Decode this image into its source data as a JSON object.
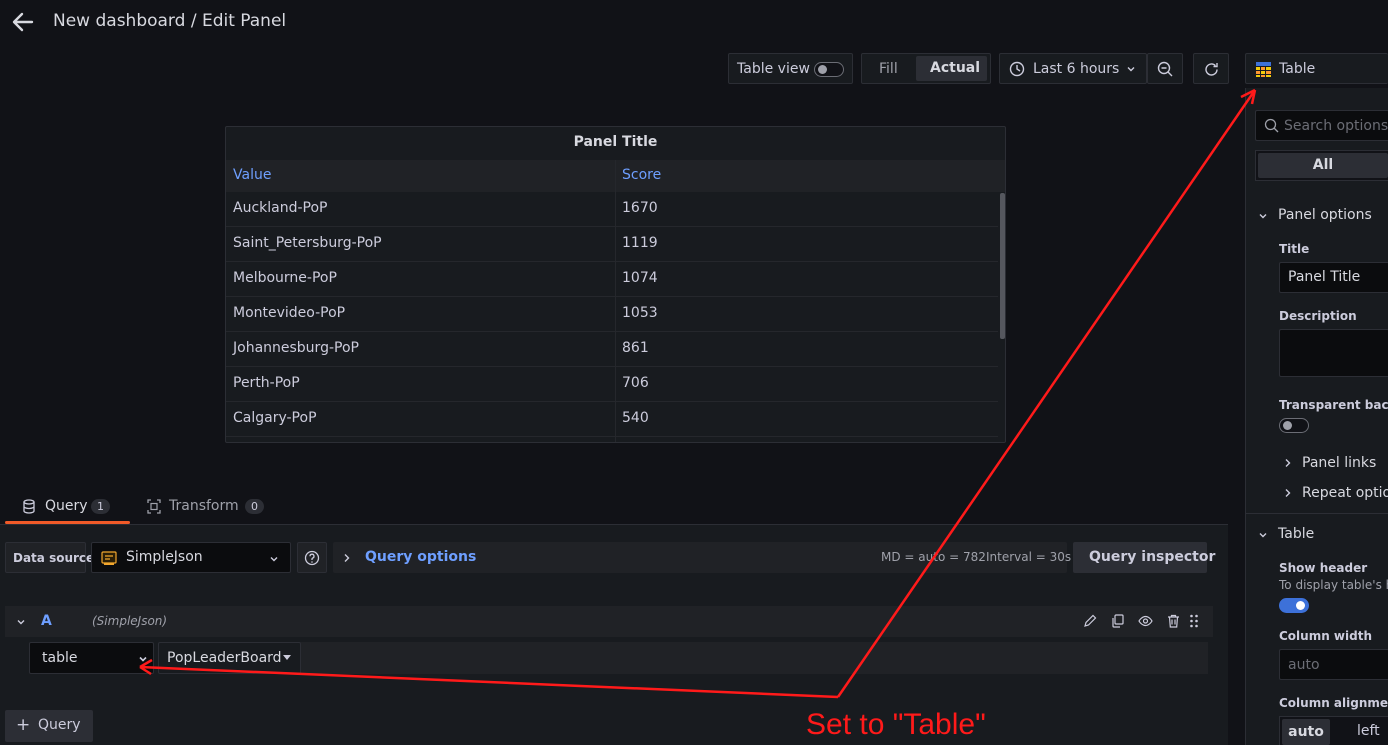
{
  "header": {
    "title": "New dashboard / Edit Panel"
  },
  "toolbar": {
    "table_view_label": "Table view",
    "fill_label": "Fill",
    "actual_label": "Actual",
    "time_range": "Last 6 hours"
  },
  "viz_picker": {
    "label": "Table"
  },
  "panel": {
    "title": "Panel Title",
    "columns": [
      "Value",
      "Score"
    ],
    "rows": [
      {
        "value": "Auckland-PoP",
        "score": "1670"
      },
      {
        "value": "Saint_Petersburg-PoP",
        "score": "1119"
      },
      {
        "value": "Melbourne-PoP",
        "score": "1074"
      },
      {
        "value": "Montevideo-PoP",
        "score": "1053"
      },
      {
        "value": "Johannesburg-PoP",
        "score": "861"
      },
      {
        "value": "Perth-PoP",
        "score": "706"
      },
      {
        "value": "Calgary-PoP",
        "score": "540"
      }
    ]
  },
  "query_tabs": {
    "query_label": "Query",
    "query_count": "1",
    "transform_label": "Transform",
    "transform_count": "0"
  },
  "query_bar": {
    "data_source_label": "Data source",
    "data_source_value": "SimpleJson",
    "query_options_label": "Query options",
    "md_text": "MD = auto = 782",
    "interval_text": "Interval = 30s",
    "inspector_label": "Query inspector"
  },
  "query_row": {
    "ref_id": "A",
    "datasource_hint": "(SimpleJson)",
    "format_value": "table",
    "target_value": "PopLeaderBoard"
  },
  "add_query_label": "Query",
  "options": {
    "search_placeholder": "Search options",
    "all_label": "All",
    "panel_options_header": "Panel options",
    "title_label": "Title",
    "title_value": "Panel Title",
    "description_label": "Description",
    "transparent_label": "Transparent backgro",
    "panel_links_label": "Panel links",
    "repeat_options_label": "Repeat option",
    "table_header": "Table",
    "show_header_label": "Show header",
    "show_header_desc": "To display table's he",
    "column_width_label": "Column width",
    "column_width_placeholder": "auto",
    "column_alignment_label": "Column alignment",
    "alignment_auto": "auto",
    "alignment_left": "left"
  },
  "annotation": {
    "text": "Set to \"Table\""
  },
  "colors": {
    "accent": "#6e9fff",
    "tab_underline": "#f05a28",
    "annotation": "#ff1a1a",
    "toggle_on": "#3d71d9"
  }
}
